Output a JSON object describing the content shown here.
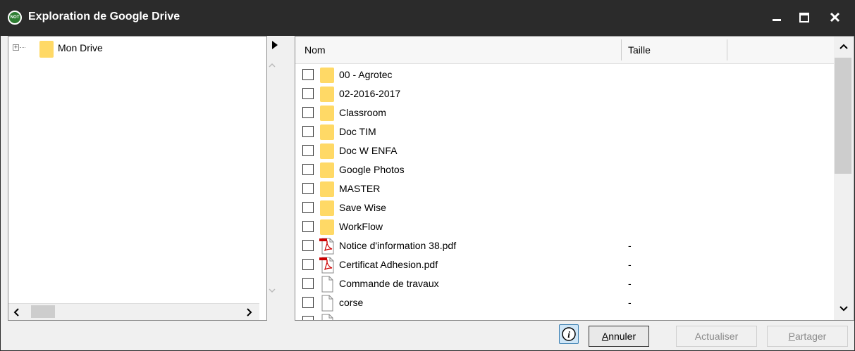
{
  "window": {
    "title": "Exploration de Google Drive",
    "app_icon_text": "NOT"
  },
  "tree": {
    "items": [
      {
        "label": "Mon Drive",
        "expander": "+"
      }
    ]
  },
  "list": {
    "columns": {
      "name": "Nom",
      "size": "Taille"
    },
    "rows": [
      {
        "name": "00 - Agrotec",
        "type": "folder",
        "size": ""
      },
      {
        "name": "02-2016-2017",
        "type": "folder",
        "size": ""
      },
      {
        "name": "Classroom",
        "type": "folder",
        "size": ""
      },
      {
        "name": "Doc TIM",
        "type": "folder",
        "size": ""
      },
      {
        "name": "Doc W ENFA",
        "type": "folder",
        "size": ""
      },
      {
        "name": "Google Photos",
        "type": "folder",
        "size": ""
      },
      {
        "name": "MASTER",
        "type": "folder",
        "size": ""
      },
      {
        "name": "Save Wise",
        "type": "folder",
        "size": ""
      },
      {
        "name": "WorkFlow",
        "type": "folder",
        "size": ""
      },
      {
        "name": "Notice d'information 38.pdf",
        "type": "pdf",
        "size": "-"
      },
      {
        "name": "Certificat Adhesion.pdf",
        "type": "pdf",
        "size": "-"
      },
      {
        "name": "Commande de travaux",
        "type": "file",
        "size": "-"
      },
      {
        "name": "corse",
        "type": "file",
        "size": "-"
      },
      {
        "name": "",
        "type": "file",
        "size": ""
      }
    ]
  },
  "buttons": {
    "cancel": {
      "first": "A",
      "rest": "nnuler"
    },
    "refresh": "Actualiser",
    "share": {
      "first": "P",
      "rest": "artager"
    }
  },
  "colors": {
    "titlebar": "#2b2b2b",
    "folder": "#ffd966",
    "pdf": "#cc0000",
    "info": "#cfe6f7"
  }
}
